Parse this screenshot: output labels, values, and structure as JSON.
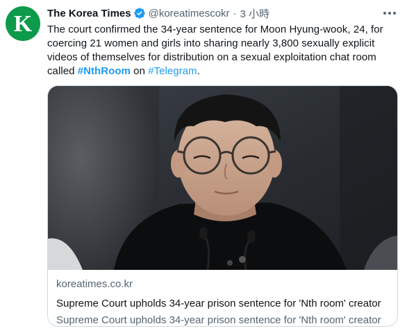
{
  "author": {
    "avatar_letter": "K",
    "display_name": "The Korea Times",
    "handle": "@koreatimescokr",
    "separator": "·",
    "time": "3 小時"
  },
  "tweet": {
    "text_before": "The court confirmed the 34-year sentence for Moon Hyung-wook, 24, for coercing 21 women and girls into sharing nearly 3,800 sexually explicit videos of themselves for distribution on a sexual exploitation chat room called ",
    "hashtag_1": "#NthRoom",
    "text_middle": " on ",
    "hashtag_2": "#Telegram",
    "text_after": "."
  },
  "card": {
    "domain": "koreatimes.co.kr",
    "title": "Supreme Court upholds 34-year prison sentence for 'Nth room' creator",
    "description": "Supreme Court upholds 34-year prison sentence for 'Nth room' creator"
  },
  "colors": {
    "avatar_bg": "#0d9a4a",
    "link": "#1d9bf0",
    "secondary_text": "#536471",
    "border": "#cfd9de"
  },
  "icons": {
    "verified": "verified-badge-icon",
    "more": "more-options-icon"
  }
}
